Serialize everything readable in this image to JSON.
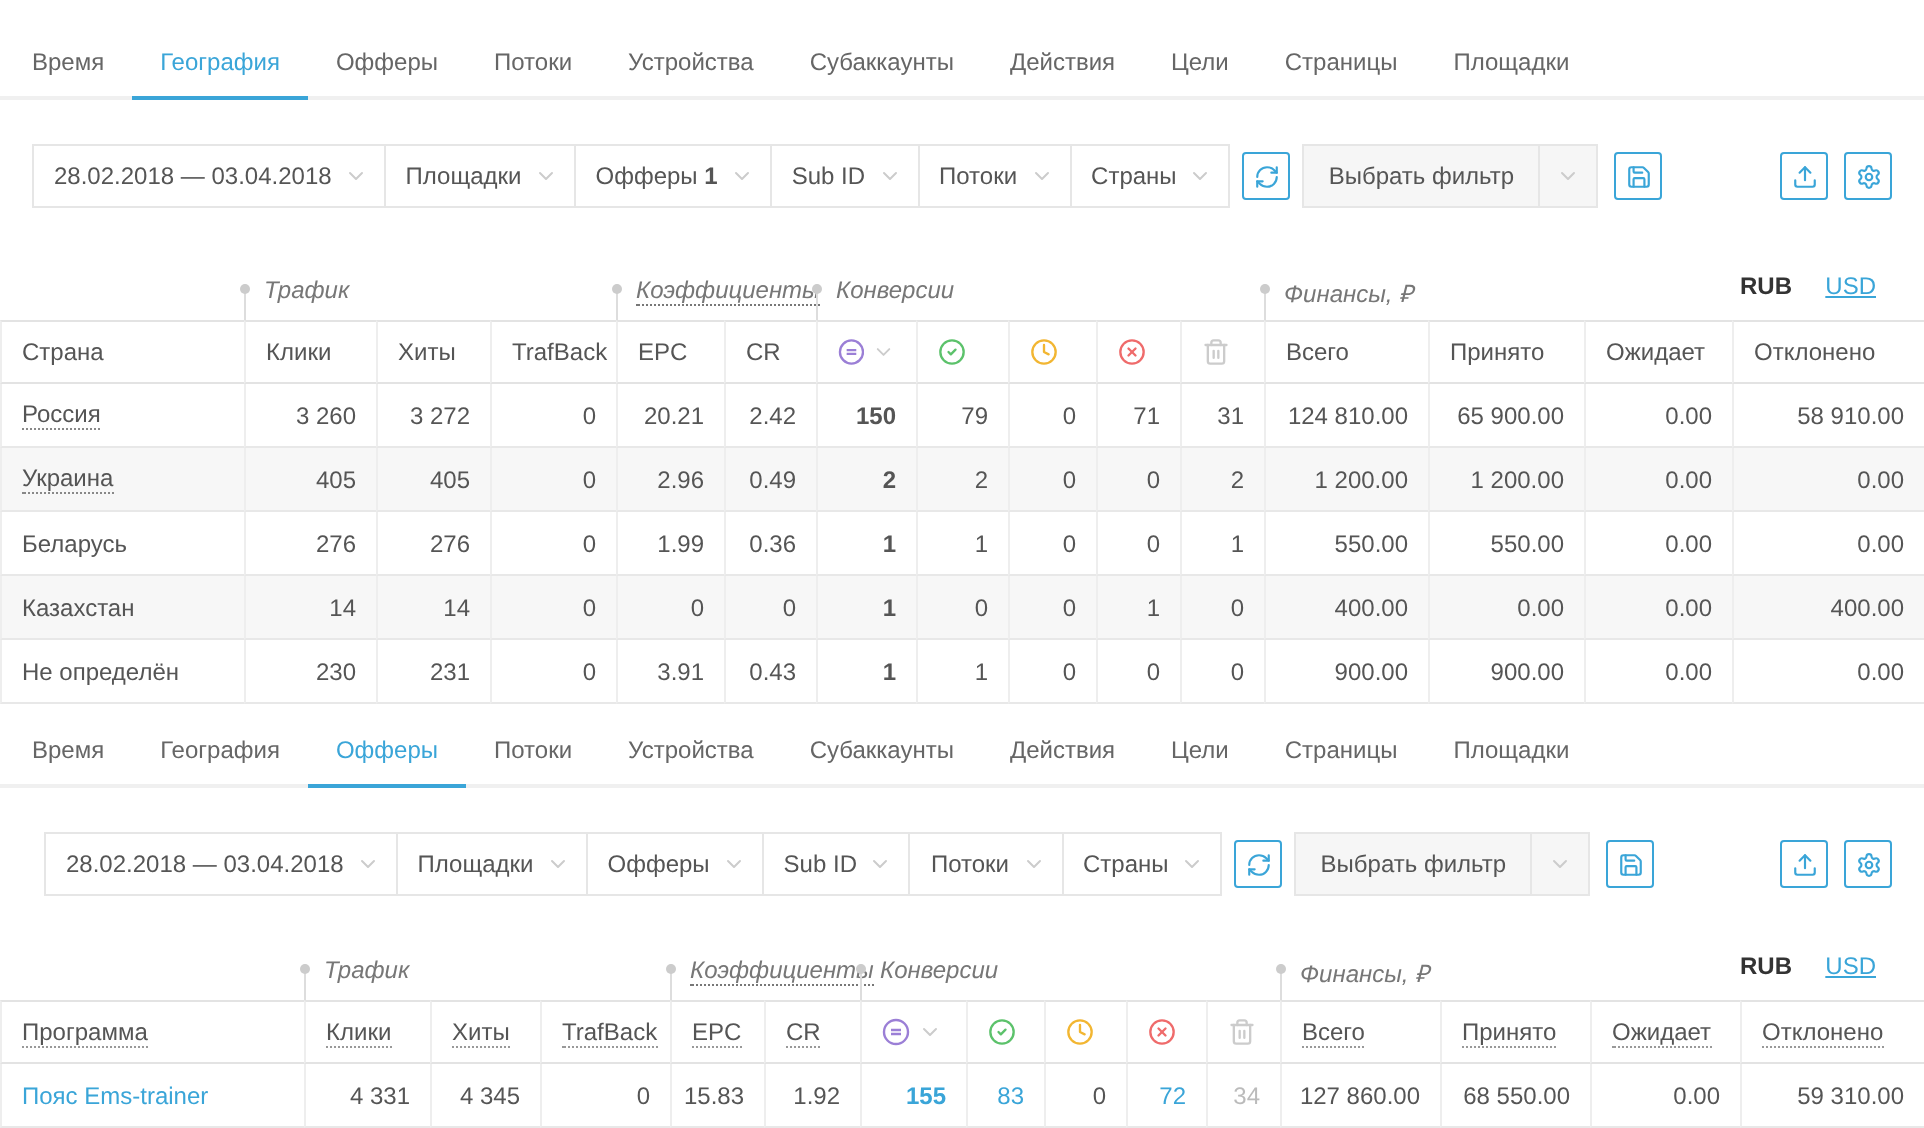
{
  "panels": [
    {
      "tabs": [
        {
          "label": "Время",
          "selected": false
        },
        {
          "label": "География",
          "selected": true
        },
        {
          "label": "Офферы",
          "selected": false
        },
        {
          "label": "Потоки",
          "selected": false
        },
        {
          "label": "Устройства",
          "selected": false
        },
        {
          "label": "Субаккаунты",
          "selected": false
        },
        {
          "label": "Действия",
          "selected": false
        },
        {
          "label": "Цели",
          "selected": false
        },
        {
          "label": "Страницы",
          "selected": false
        },
        {
          "label": "Площадки",
          "selected": false
        }
      ],
      "filters": [
        {
          "label": "28.02.2018 — 03.04.2018"
        },
        {
          "label": "Площадки"
        },
        {
          "label": "Офферы",
          "count": "1"
        },
        {
          "label": "Sub ID"
        },
        {
          "label": "Потоки"
        },
        {
          "label": "Страны"
        }
      ],
      "filter_select": "Выбрать фильтр",
      "currencies": [
        {
          "label": "RUB",
          "selected": true
        },
        {
          "label": "USD",
          "selected": false
        }
      ],
      "dotted_headers": false,
      "columns": [
        {
          "label": "Страна"
        },
        {
          "label": "Клики",
          "group": "Трафик"
        },
        {
          "label": "Хиты"
        },
        {
          "label": "TrafBack"
        },
        {
          "label": "EPC",
          "group": "Коэффициенты",
          "group_dotted": true
        },
        {
          "label": "CR"
        },
        {
          "kind": "icon",
          "group": "Конверсии"
        },
        {
          "kind": "icon"
        },
        {
          "kind": "icon"
        },
        {
          "kind": "icon"
        },
        {
          "kind": "icon"
        },
        {
          "label": "Всего",
          "group": "Финансы, ₽"
        },
        {
          "label": "Принято"
        },
        {
          "label": "Ожидает"
        },
        {
          "label": "Отклонено"
        }
      ],
      "rows": [
        {
          "name": "Россия",
          "dotted": true,
          "link": false,
          "values": [
            "3 260",
            "3 272",
            "0",
            "20.21",
            "2.42",
            "150",
            "79",
            "0",
            "71",
            "31",
            "124 810.00",
            "65 900.00",
            "0.00",
            "58 910.00"
          ]
        },
        {
          "name": "Украина",
          "dotted": true,
          "link": false,
          "values": [
            "405",
            "405",
            "0",
            "2.96",
            "0.49",
            "2",
            "2",
            "0",
            "0",
            "2",
            "1 200.00",
            "1 200.00",
            "0.00",
            "0.00"
          ]
        },
        {
          "name": "Беларусь",
          "dotted": false,
          "link": false,
          "values": [
            "276",
            "276",
            "0",
            "1.99",
            "0.36",
            "1",
            "1",
            "0",
            "0",
            "1",
            "550.00",
            "550.00",
            "0.00",
            "0.00"
          ]
        },
        {
          "name": "Казахстан",
          "dotted": false,
          "link": false,
          "values": [
            "14",
            "14",
            "0",
            "0",
            "0",
            "1",
            "0",
            "0",
            "1",
            "0",
            "400.00",
            "0.00",
            "0.00",
            "400.00"
          ]
        },
        {
          "name": "Не определён",
          "dotted": false,
          "link": false,
          "values": [
            "230",
            "231",
            "0",
            "3.91",
            "0.43",
            "1",
            "1",
            "0",
            "0",
            "0",
            "900.00",
            "900.00",
            "0.00",
            "0.00"
          ]
        }
      ]
    },
    {
      "tabs": [
        {
          "label": "Время",
          "selected": false
        },
        {
          "label": "География",
          "selected": false
        },
        {
          "label": "Офферы",
          "selected": true
        },
        {
          "label": "Потоки",
          "selected": false
        },
        {
          "label": "Устройства",
          "selected": false
        },
        {
          "label": "Субаккаунты",
          "selected": false
        },
        {
          "label": "Действия",
          "selected": false
        },
        {
          "label": "Цели",
          "selected": false
        },
        {
          "label": "Страницы",
          "selected": false
        },
        {
          "label": "Площадки",
          "selected": false
        }
      ],
      "filters": [
        {
          "label": "28.02.2018 — 03.04.2018"
        },
        {
          "label": "Площадки"
        },
        {
          "label": "Офферы"
        },
        {
          "label": "Sub ID"
        },
        {
          "label": "Потоки"
        },
        {
          "label": "Страны"
        }
      ],
      "filter_select": "Выбрать фильтр",
      "currencies": [
        {
          "label": "RUB",
          "selected": true
        },
        {
          "label": "USD",
          "selected": false
        }
      ],
      "dotted_headers": true,
      "columns": [
        {
          "label": "Программа"
        },
        {
          "label": "Клики",
          "group": "Трафик"
        },
        {
          "label": "Хиты"
        },
        {
          "label": "TrafBack"
        },
        {
          "label": "EPC",
          "group": "Коэффициенты",
          "group_dotted": true
        },
        {
          "label": "CR"
        },
        {
          "kind": "icon",
          "group": "Конверсии"
        },
        {
          "kind": "icon"
        },
        {
          "kind": "icon"
        },
        {
          "kind": "icon"
        },
        {
          "kind": "icon"
        },
        {
          "label": "Всего",
          "group": "Финансы, ₽"
        },
        {
          "label": "Принято"
        },
        {
          "label": "Ожидает"
        },
        {
          "label": "Отклонено"
        }
      ],
      "rows": [
        {
          "name": "Пояс Ems-trainer",
          "dotted": false,
          "link": true,
          "values": [
            "4 331",
            "4 345",
            "0",
            "15.83",
            "1.92",
            "155",
            "83",
            "0",
            "72",
            "34",
            "127 860.00",
            "68 550.00",
            "0.00",
            "59 310.00"
          ],
          "linked": [
            false,
            false,
            false,
            false,
            false,
            true,
            true,
            false,
            true,
            false,
            false,
            false,
            false,
            false
          ],
          "muted": [
            false,
            false,
            false,
            false,
            false,
            false,
            false,
            false,
            false,
            true,
            false,
            false,
            false,
            false
          ]
        }
      ]
    }
  ]
}
